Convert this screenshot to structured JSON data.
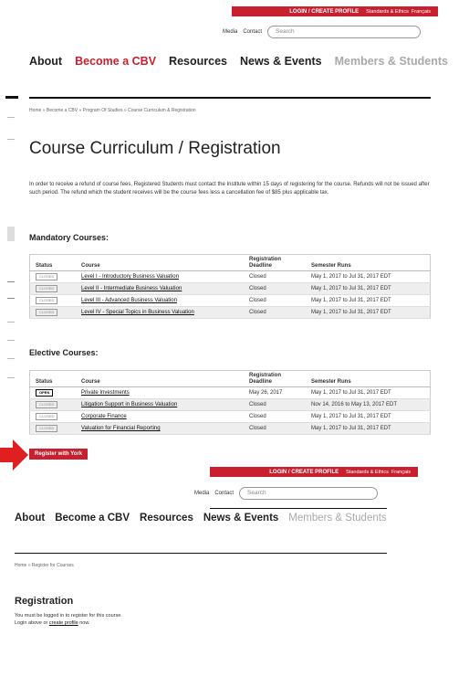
{
  "header1": {
    "login": "LOGIN / CREATE PROFILE",
    "standards": "Standards & Ethics",
    "francais": "Français",
    "media": "Media",
    "contact": "Contact",
    "search_placeholder": "Search",
    "nav": [
      "About",
      "Become a CBV",
      "Resources",
      "News & Events",
      "Members & Students"
    ]
  },
  "page1": {
    "breadcrumb": "Home  »  Become a CBV  » Program Of Studies  »  Course Curriculum & Registration",
    "title": "Course Curriculum / Registration",
    "intro": "In order to receive a refund of course fees, Registered Students must contact the Institute within 15 days of registering for the course. Refunds will not be issued after such period. The refund which the student receives will be the course fees less a cancellation fee of $85 plus applicable tax.",
    "columns": [
      "Status",
      "Course",
      "Registration Deadline",
      "Semester Runs"
    ],
    "mandatory_heading": "Mandatory Courses:",
    "mandatory": [
      {
        "status": "CLOSED",
        "course": "Level I - Introductory Business Valuation",
        "deadline": "Closed",
        "runs": "May 1, 2017 to Jul 31, 2017 EDT"
      },
      {
        "status": "CLOSED",
        "course": "Level II - Intermediate Business Valuation",
        "deadline": "Closed",
        "runs": "May 1, 2017 to Jul 31, 2017 EDT"
      },
      {
        "status": "CLOSED",
        "course": "Level III - Advanced Business Valuation",
        "deadline": "Closed",
        "runs": "May 1, 2017 to Jul 31, 2017 EDT"
      },
      {
        "status": "CLOSED",
        "course": "Level IV - Special Topics in Business Valuation",
        "deadline": "Closed",
        "runs": "May 1, 2017 to Jul 31, 2017 EDT"
      }
    ],
    "elective_heading": "Elective Courses:",
    "elective": [
      {
        "status": "OPEN",
        "course": "Private Investments",
        "deadline": "May 26, 2017",
        "runs": "May 1, 2017 to Jul 31, 2017 EDT"
      },
      {
        "status": "CLOSED",
        "course": "Litigation Support in Business Valuation",
        "deadline": "Closed",
        "runs": "Nov 14, 2016 to May 13, 2017 EDT"
      },
      {
        "status": "CLOSED",
        "course": "Corporate Finance",
        "deadline": "Closed",
        "runs": "May 1, 2017 to Jul 31, 2017 EDT"
      },
      {
        "status": "CLOSED",
        "course": "Valuation for Financial Reporting",
        "deadline": "Closed",
        "runs": "May 1, 2017 to Jul 31, 2017 EDT"
      }
    ],
    "register_button": "Register with York"
  },
  "page2": {
    "breadcrumb": "Home  »  Register for Courses",
    "title": "Registration",
    "line1": "You must be logged in to register for this course.",
    "line2_prefix": "Login above or ",
    "line2_link": "create profile",
    "line2_suffix": " now."
  },
  "colors": {
    "brand_red": "#c8202f",
    "nav_muted": "#aaa",
    "arrow_red": "#e02020"
  }
}
